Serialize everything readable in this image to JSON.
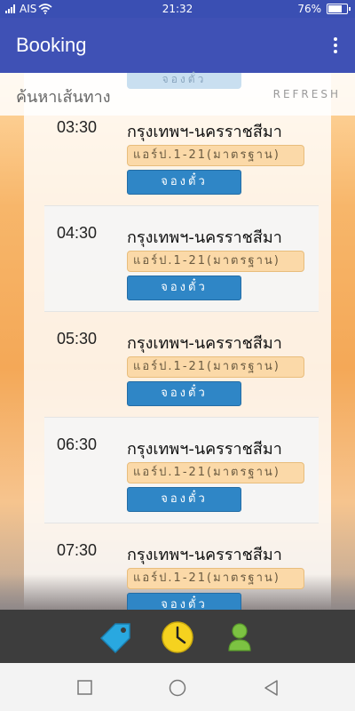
{
  "status_bar": {
    "carrier": "AIS",
    "time": "21:32",
    "battery": "76%",
    "battery_level": 0.76
  },
  "app_bar": {
    "title": "Booking",
    "menu_icon": "more-vert-icon"
  },
  "search": {
    "label": "ค้นหาเส้นทาง",
    "refresh_label": "REFRESH"
  },
  "partial_button_label": "จองตั๋ว",
  "trips": [
    {
      "time": "03:30",
      "destination": "กรุงเทพฯ-นครราชสีมา",
      "bus_type": "แอร์ป.1-21(มาตรฐาน)",
      "book_label": "จองตั๋ว"
    },
    {
      "time": "04:30",
      "destination": "กรุงเทพฯ-นครราชสีมา",
      "bus_type": "แอร์ป.1-21(มาตรฐาน)",
      "book_label": "จองตั๋ว"
    },
    {
      "time": "05:30",
      "destination": "กรุงเทพฯ-นครราชสีมา",
      "bus_type": "แอร์ป.1-21(มาตรฐาน)",
      "book_label": "จองตั๋ว"
    },
    {
      "time": "06:30",
      "destination": "กรุงเทพฯ-นครราชสีมา",
      "bus_type": "แอร์ป.1-21(มาตรฐาน)",
      "book_label": "จองตั๋ว"
    },
    {
      "time": "07:30",
      "destination": "กรุงเทพฯ-นครราชสีมา",
      "bus_type": "แอร์ป.1-21(มาตรฐาน)",
      "book_label": "จองตั๋ว"
    }
  ],
  "bottom_tabs": [
    {
      "icon": "tag-icon",
      "color": "#29a8e0"
    },
    {
      "icon": "clock-icon",
      "color": "#f5d21f"
    },
    {
      "icon": "user-icon",
      "color": "#7cc242"
    }
  ],
  "nav_bar": {
    "buttons": [
      "recents-icon",
      "home-icon",
      "back-icon"
    ]
  },
  "colors": {
    "primary": "#3f51b5",
    "book_button": "#2f86c6",
    "bus_type_chip": "#fbd9a8"
  }
}
